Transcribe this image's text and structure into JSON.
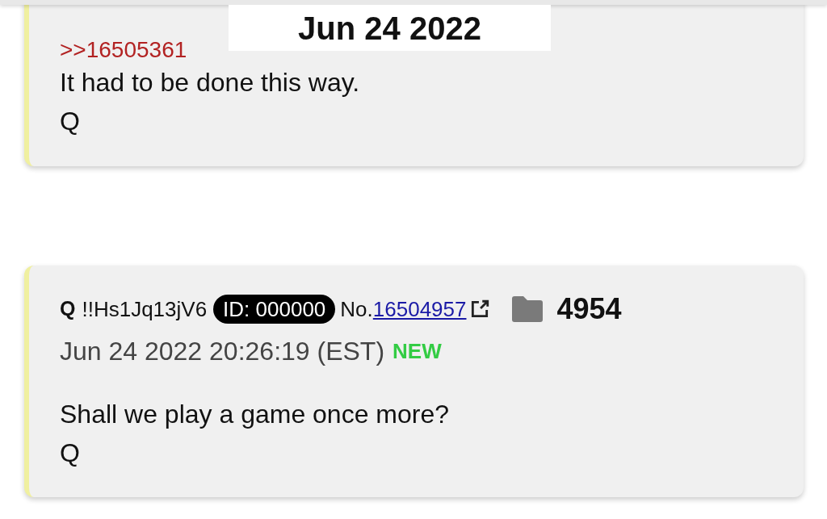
{
  "date_banner": "Jun 24 2022",
  "posts": [
    {
      "kind": "partial",
      "reply_link": ">>16505361",
      "lines": [
        "It had to be done this way.",
        "Q"
      ]
    },
    {
      "kind": "full",
      "name": "Q",
      "tripcode": "!!Hs1Jq13jV6",
      "id": "ID: 000000",
      "no_label": "No.",
      "number": "16504957",
      "count": "4954",
      "timestamp": "Jun 24 2022 20:26:19 (EST)",
      "new_label": "NEW",
      "lines": [
        "Shall we play a game once more?",
        "Q"
      ]
    }
  ]
}
